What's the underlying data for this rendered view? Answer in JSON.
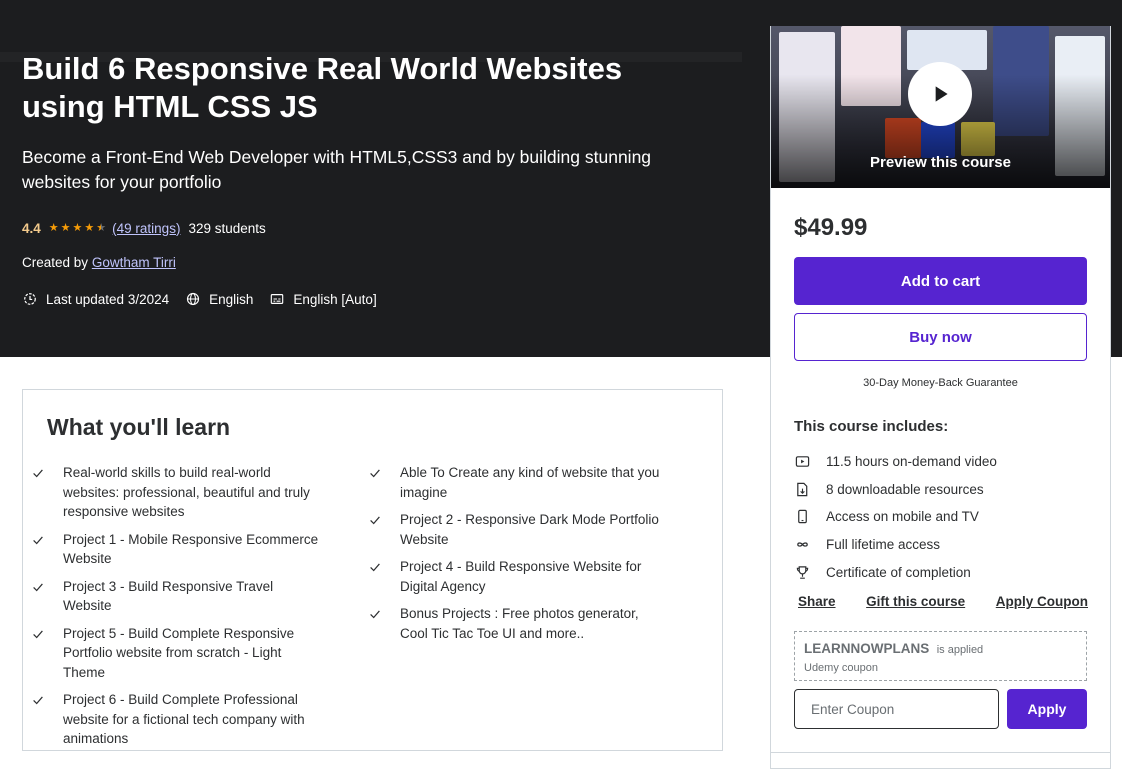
{
  "course": {
    "title": "Build 6 Responsive Real World Websites using HTML CSS JS",
    "subtitle": "Become a Front-End Web Developer with HTML5,CSS3 and by building stunning websites for your portfolio",
    "rating": "4.4",
    "rating_fraction": 0.88,
    "ratings_count": "(49 ratings)",
    "students": "329 students",
    "created_by_label": "Created by",
    "author": "Gowtham Tirri",
    "last_updated": "Last updated 3/2024",
    "language": "English",
    "captions": "English [Auto]"
  },
  "sidebar": {
    "preview_label": "Preview this course",
    "price": "$49.99",
    "add_to_cart": "Add to cart",
    "buy_now": "Buy now",
    "guarantee": "30-Day Money-Back Guarantee",
    "includes_title": "This course includes:",
    "includes": [
      {
        "icon": "video-icon",
        "text": "11.5 hours on-demand video"
      },
      {
        "icon": "file-download-icon",
        "text": "8 downloadable resources"
      },
      {
        "icon": "mobile-icon",
        "text": "Access on mobile and TV"
      },
      {
        "icon": "infinity-icon",
        "text": "Full lifetime access"
      },
      {
        "icon": "trophy-icon",
        "text": "Certificate of completion"
      }
    ],
    "links": {
      "share": "Share",
      "gift": "Gift this course",
      "apply_coupon": "Apply Coupon"
    },
    "coupon": {
      "code": "LEARNNOWPLANS",
      "applied": "is applied",
      "source": "Udemy coupon",
      "placeholder": "Enter Coupon",
      "apply": "Apply"
    }
  },
  "learn": {
    "title": "What you'll learn",
    "left": [
      "Real-world skills to build real-world websites: professional, beautiful and truly responsive websites",
      "Project 1 - Mobile Responsive Ecommerce Website",
      "Project 3 - Build Responsive Travel Website",
      "Project 5 - Build Complete Responsive Portfolio website from scratch - Light Theme",
      "Project 6 - Build Complete Professional website for a fictional tech company with animations"
    ],
    "right": [
      "Able To Create any kind of website that you imagine",
      "Project 2 - Responsive Dark Mode Portfolio Website",
      "Project 4 - Build Responsive Website for Digital Agency",
      "Bonus Projects : Free photos generator, Cool Tic Tac Toe UI and more.."
    ]
  },
  "colors": {
    "hero_bg": "#1c1d1f",
    "accent_purple": "#5624d0",
    "star": "#f69c08",
    "rating_text": "#f3ca8c",
    "link_light": "#c0c4fc"
  }
}
